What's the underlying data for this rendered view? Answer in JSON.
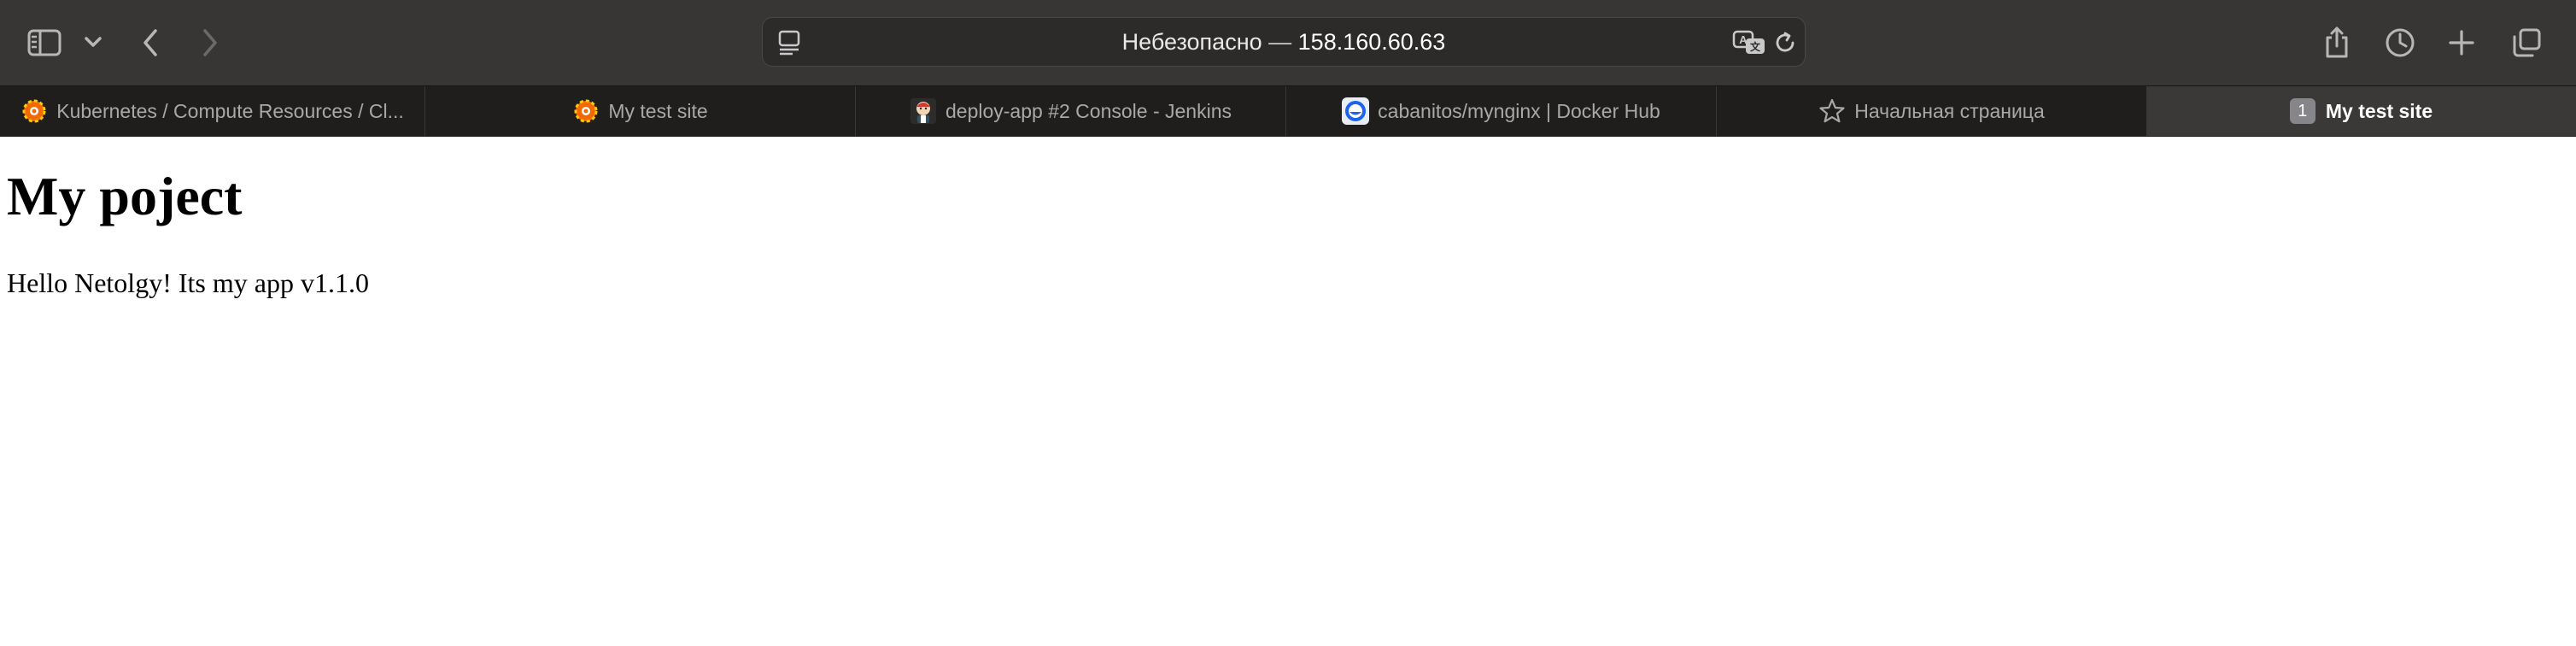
{
  "toolbar": {
    "address": {
      "security_text": "Небезопасно",
      "separator": "—",
      "host": "158.160.60.63"
    },
    "icons": {
      "sidebar": "sidebar-icon",
      "sidebar_menu": "chevron-down-icon",
      "back": "chevron-left-icon",
      "forward": "chevron-right-icon",
      "reader": "reader-icon",
      "translate": "translate-icon",
      "reload": "reload-icon",
      "share": "share-icon",
      "history": "clock-icon",
      "new_tab": "plus-icon",
      "tab_overview": "tab-overview-icon"
    }
  },
  "tabs": [
    {
      "label": "Kubernetes / Compute Resources / Cl...",
      "favicon": "grafana-icon",
      "active": false
    },
    {
      "label": "My test site",
      "favicon": "grafana-icon",
      "active": false
    },
    {
      "label": "deploy-app #2 Console - Jenkins",
      "favicon": "jenkins-icon",
      "active": false
    },
    {
      "label": "cabanitos/mynginx | Docker Hub",
      "favicon": "docker-icon",
      "active": false
    },
    {
      "label": "Начальная страница",
      "favicon": "star-icon",
      "active": false
    },
    {
      "label": "My test site",
      "badge": "1",
      "active": true
    }
  ],
  "page": {
    "heading": "My poject",
    "text": "Hello Netolgy! Its my app v1.1.0"
  },
  "colors": {
    "toolbar_bg": "#383634",
    "tabbar_bg": "#1f1e1d",
    "active_tab_bg": "#3a3937",
    "page_bg": "#ffffff"
  }
}
